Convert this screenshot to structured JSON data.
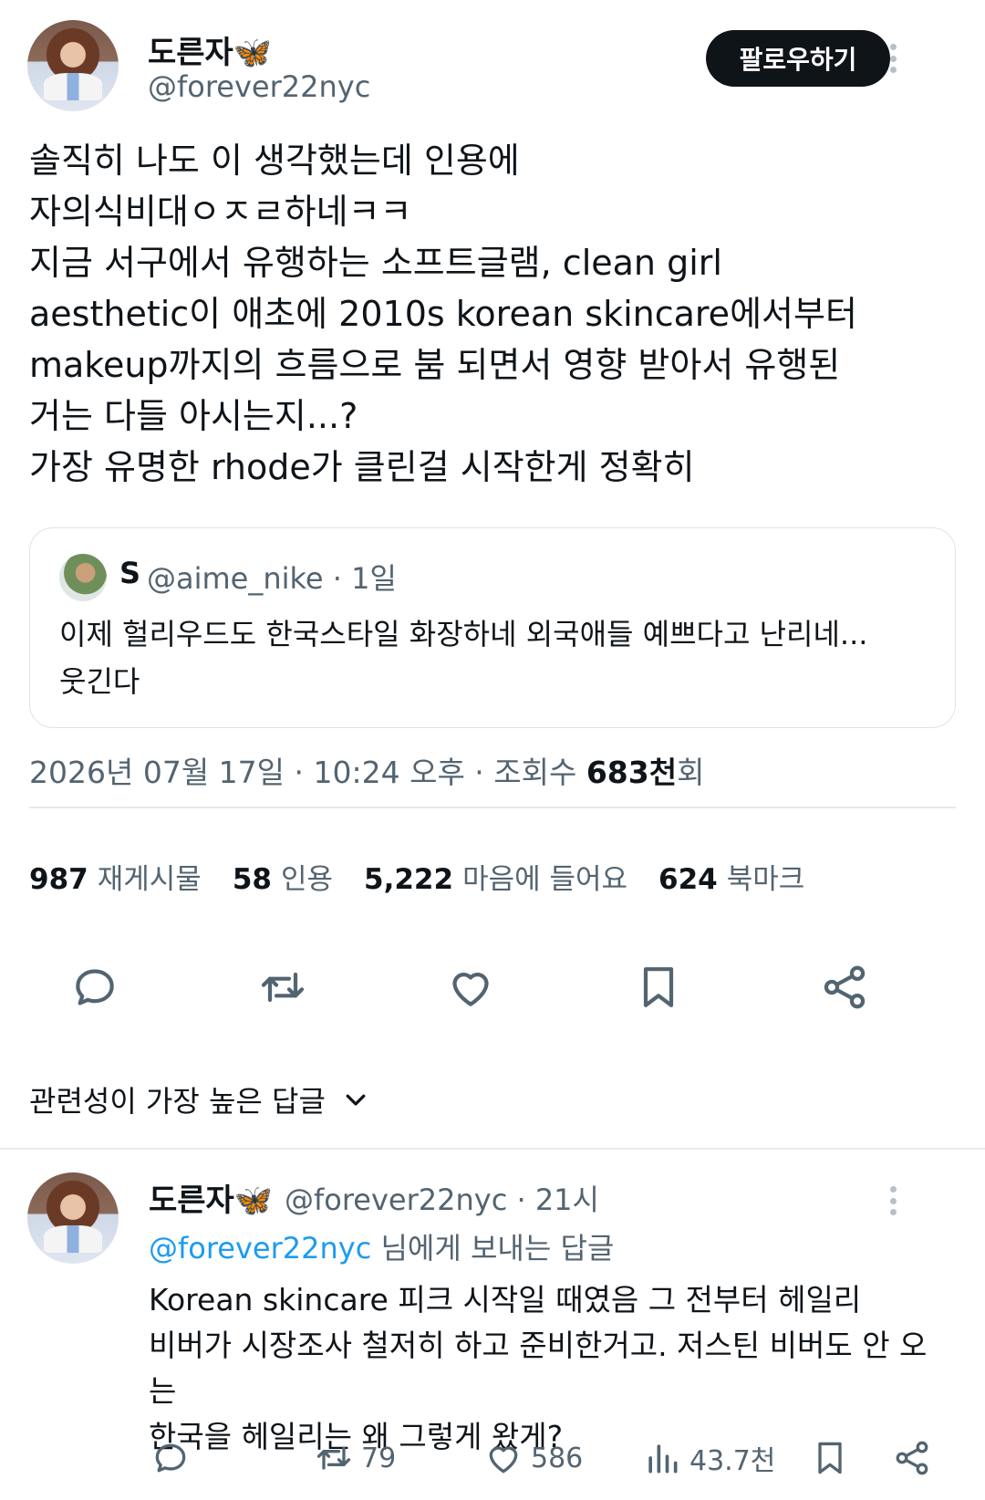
{
  "tweet": {
    "author_name": "도른자🦋",
    "author_handle": "@forever22nyc",
    "follow_label": "팔로우하기",
    "text": "솔직히 나도 이 생각했는데 인용에\n자의식비대ㅇㅈㄹ하네ㅋㅋ\n지금 서구에서 유행하는 소프트글램, clean girl\naesthetic이 애초에 2010s korean skincare에서부터\nmakeup까지의 흐름으로 붐 되면서 영향 받아서 유행된\n거는 다들 아시는지...?\n가장 유명한 rhode가 클린걸 시작한게 정확히",
    "quote": {
      "name": "S",
      "handle": "@aime_nike · 1일",
      "text": "이제 헐리우드도 한국스타일 화장하네 외국애들 예쁘다고 난리네...\n웃긴다"
    },
    "timestamp": "2026년 07월 17일 · 10:24 오후 · 조회수 ",
    "views": "683천",
    "views_suffix": "회",
    "stats": {
      "reposts_count": "987",
      "reposts_label": "재게시물",
      "quotes_count": "58",
      "quotes_label": "인용",
      "likes_count": "5,222",
      "likes_label": "마음에 들어요",
      "bookmarks_count": "624",
      "bookmarks_label": "북마크"
    },
    "action_icons": [
      "reply-icon",
      "repost-icon",
      "like-icon",
      "bookmark-icon",
      "share-icon"
    ]
  },
  "sort": {
    "label": "관련성이 가장 높은 답글"
  },
  "reply": {
    "author_name": "도른자🦋",
    "author_handle": "@forever22nyc · 21시",
    "replying_mention": "@forever22nyc",
    "replying_suffix": " 님에게 보내는 답글",
    "text": "Korean skincare 피크 시작일 때였음 그 전부터 헤일리\n비버가 시장조사 철저히 하고 준비한거고. 저스틴 비버도 안 오는\n한국을 헤일리는 왜 그렇게 왔게?",
    "reposts": "79",
    "likes": "586",
    "views": "43.7천"
  },
  "colors": {
    "text": "#0f1419",
    "muted": "#536471",
    "accent": "#1d9bf0",
    "border": "#e6eaed"
  }
}
